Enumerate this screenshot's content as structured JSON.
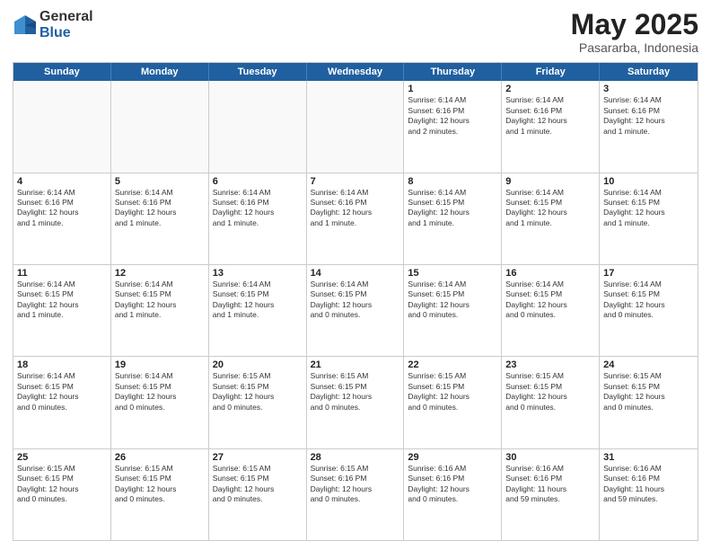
{
  "header": {
    "logo_general": "General",
    "logo_blue": "Blue",
    "title": "May 2025",
    "location": "Pasararba, Indonesia"
  },
  "calendar": {
    "days_of_week": [
      "Sunday",
      "Monday",
      "Tuesday",
      "Wednesday",
      "Thursday",
      "Friday",
      "Saturday"
    ],
    "weeks": [
      [
        {
          "day": "",
          "info": "",
          "empty": true
        },
        {
          "day": "",
          "info": "",
          "empty": true
        },
        {
          "day": "",
          "info": "",
          "empty": true
        },
        {
          "day": "",
          "info": "",
          "empty": true
        },
        {
          "day": "1",
          "info": "Sunrise: 6:14 AM\nSunset: 6:16 PM\nDaylight: 12 hours\nand 2 minutes.",
          "empty": false
        },
        {
          "day": "2",
          "info": "Sunrise: 6:14 AM\nSunset: 6:16 PM\nDaylight: 12 hours\nand 1 minute.",
          "empty": false
        },
        {
          "day": "3",
          "info": "Sunrise: 6:14 AM\nSunset: 6:16 PM\nDaylight: 12 hours\nand 1 minute.",
          "empty": false
        }
      ],
      [
        {
          "day": "4",
          "info": "Sunrise: 6:14 AM\nSunset: 6:16 PM\nDaylight: 12 hours\nand 1 minute.",
          "empty": false
        },
        {
          "day": "5",
          "info": "Sunrise: 6:14 AM\nSunset: 6:16 PM\nDaylight: 12 hours\nand 1 minute.",
          "empty": false
        },
        {
          "day": "6",
          "info": "Sunrise: 6:14 AM\nSunset: 6:16 PM\nDaylight: 12 hours\nand 1 minute.",
          "empty": false
        },
        {
          "day": "7",
          "info": "Sunrise: 6:14 AM\nSunset: 6:16 PM\nDaylight: 12 hours\nand 1 minute.",
          "empty": false
        },
        {
          "day": "8",
          "info": "Sunrise: 6:14 AM\nSunset: 6:15 PM\nDaylight: 12 hours\nand 1 minute.",
          "empty": false
        },
        {
          "day": "9",
          "info": "Sunrise: 6:14 AM\nSunset: 6:15 PM\nDaylight: 12 hours\nand 1 minute.",
          "empty": false
        },
        {
          "day": "10",
          "info": "Sunrise: 6:14 AM\nSunset: 6:15 PM\nDaylight: 12 hours\nand 1 minute.",
          "empty": false
        }
      ],
      [
        {
          "day": "11",
          "info": "Sunrise: 6:14 AM\nSunset: 6:15 PM\nDaylight: 12 hours\nand 1 minute.",
          "empty": false
        },
        {
          "day": "12",
          "info": "Sunrise: 6:14 AM\nSunset: 6:15 PM\nDaylight: 12 hours\nand 1 minute.",
          "empty": false
        },
        {
          "day": "13",
          "info": "Sunrise: 6:14 AM\nSunset: 6:15 PM\nDaylight: 12 hours\nand 1 minute.",
          "empty": false
        },
        {
          "day": "14",
          "info": "Sunrise: 6:14 AM\nSunset: 6:15 PM\nDaylight: 12 hours\nand 0 minutes.",
          "empty": false
        },
        {
          "day": "15",
          "info": "Sunrise: 6:14 AM\nSunset: 6:15 PM\nDaylight: 12 hours\nand 0 minutes.",
          "empty": false
        },
        {
          "day": "16",
          "info": "Sunrise: 6:14 AM\nSunset: 6:15 PM\nDaylight: 12 hours\nand 0 minutes.",
          "empty": false
        },
        {
          "day": "17",
          "info": "Sunrise: 6:14 AM\nSunset: 6:15 PM\nDaylight: 12 hours\nand 0 minutes.",
          "empty": false
        }
      ],
      [
        {
          "day": "18",
          "info": "Sunrise: 6:14 AM\nSunset: 6:15 PM\nDaylight: 12 hours\nand 0 minutes.",
          "empty": false
        },
        {
          "day": "19",
          "info": "Sunrise: 6:14 AM\nSunset: 6:15 PM\nDaylight: 12 hours\nand 0 minutes.",
          "empty": false
        },
        {
          "day": "20",
          "info": "Sunrise: 6:15 AM\nSunset: 6:15 PM\nDaylight: 12 hours\nand 0 minutes.",
          "empty": false
        },
        {
          "day": "21",
          "info": "Sunrise: 6:15 AM\nSunset: 6:15 PM\nDaylight: 12 hours\nand 0 minutes.",
          "empty": false
        },
        {
          "day": "22",
          "info": "Sunrise: 6:15 AM\nSunset: 6:15 PM\nDaylight: 12 hours\nand 0 minutes.",
          "empty": false
        },
        {
          "day": "23",
          "info": "Sunrise: 6:15 AM\nSunset: 6:15 PM\nDaylight: 12 hours\nand 0 minutes.",
          "empty": false
        },
        {
          "day": "24",
          "info": "Sunrise: 6:15 AM\nSunset: 6:15 PM\nDaylight: 12 hours\nand 0 minutes.",
          "empty": false
        }
      ],
      [
        {
          "day": "25",
          "info": "Sunrise: 6:15 AM\nSunset: 6:15 PM\nDaylight: 12 hours\nand 0 minutes.",
          "empty": false
        },
        {
          "day": "26",
          "info": "Sunrise: 6:15 AM\nSunset: 6:15 PM\nDaylight: 12 hours\nand 0 minutes.",
          "empty": false
        },
        {
          "day": "27",
          "info": "Sunrise: 6:15 AM\nSunset: 6:15 PM\nDaylight: 12 hours\nand 0 minutes.",
          "empty": false
        },
        {
          "day": "28",
          "info": "Sunrise: 6:15 AM\nSunset: 6:16 PM\nDaylight: 12 hours\nand 0 minutes.",
          "empty": false
        },
        {
          "day": "29",
          "info": "Sunrise: 6:16 AM\nSunset: 6:16 PM\nDaylight: 12 hours\nand 0 minutes.",
          "empty": false
        },
        {
          "day": "30",
          "info": "Sunrise: 6:16 AM\nSunset: 6:16 PM\nDaylight: 11 hours\nand 59 minutes.",
          "empty": false
        },
        {
          "day": "31",
          "info": "Sunrise: 6:16 AM\nSunset: 6:16 PM\nDaylight: 11 hours\nand 59 minutes.",
          "empty": false
        }
      ]
    ]
  }
}
